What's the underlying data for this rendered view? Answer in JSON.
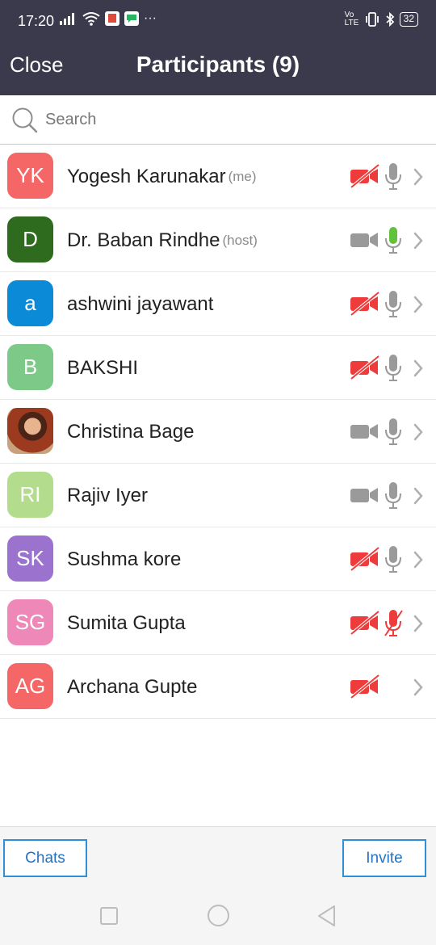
{
  "status_bar": {
    "time": "17:20",
    "ellipsis": "···",
    "volte": "Vo LTE",
    "battery": "32"
  },
  "header": {
    "close_label": "Close",
    "title": "Participants (9)"
  },
  "search": {
    "placeholder": "Search"
  },
  "participants": [
    {
      "initials": "YK",
      "name": "Yogesh Karunakar",
      "tag": "(me)",
      "avatar_color": "#f56766",
      "video": "off",
      "mic": "muted"
    },
    {
      "initials": "D",
      "name": "Dr. Baban Rindhe",
      "tag": "(host)",
      "avatar_color": "#2f6b1e",
      "video": "on",
      "mic": "active"
    },
    {
      "initials": "a",
      "name": "ashwini jayawant",
      "tag": "",
      "avatar_color": "#0b8ad8",
      "video": "off",
      "mic": "muted"
    },
    {
      "initials": "B",
      "name": "BAKSHI",
      "tag": "",
      "avatar_color": "#7dc988",
      "video": "off",
      "mic": "muted"
    },
    {
      "initials": "",
      "name": "Christina Bage",
      "tag": "",
      "avatar_color": "#9b3a1e",
      "video": "on",
      "mic": "muted"
    },
    {
      "initials": "RI",
      "name": "Rajiv Iyer",
      "tag": "",
      "avatar_color": "#b3dd8d",
      "video": "on",
      "mic": "muted"
    },
    {
      "initials": "SK",
      "name": "Sushma kore",
      "tag": "",
      "avatar_color": "#9b73cf",
      "video": "off",
      "mic": "muted"
    },
    {
      "initials": "SG",
      "name": "Sumita Gupta",
      "tag": "",
      "avatar_color": "#ee88b8",
      "video": "off",
      "mic": "off"
    },
    {
      "initials": "AG",
      "name": "Archana Gupte",
      "tag": "",
      "avatar_color": "#f56766",
      "video": "off",
      "mic": "none"
    }
  ],
  "footer": {
    "chats_label": "Chats",
    "invite_label": "Invite"
  },
  "colors": {
    "header_bg": "#3a3a4c",
    "video_off": "#ee3b3b",
    "icon_gray": "#9a9a9a",
    "mic_active": "#63c23b",
    "button_blue": "#2f8fd8"
  }
}
